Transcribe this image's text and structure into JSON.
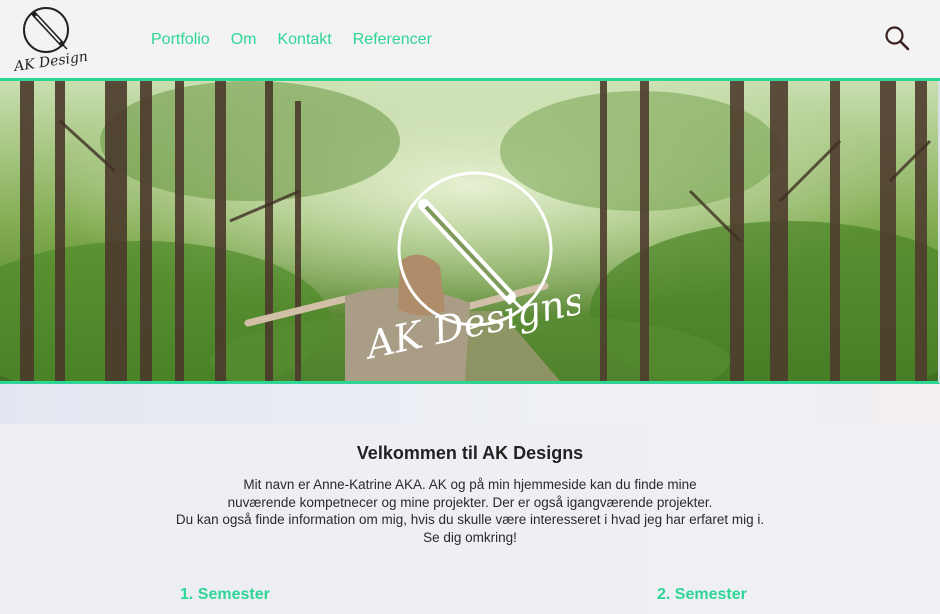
{
  "brand": {
    "logo_text": "AK Designs",
    "accent_color": "#2ed594"
  },
  "nav": {
    "items": [
      {
        "label": "Portfolio"
      },
      {
        "label": "Om"
      },
      {
        "label": "Kontakt"
      },
      {
        "label": "Referencer"
      }
    ],
    "search_icon": "search-icon"
  },
  "hero": {
    "image": "forest-woman-arms-outstretched",
    "overlay_logo_text": "AK Designs"
  },
  "welcome": {
    "title": "Velkommen til AK Designs",
    "lines": [
      "Mit navn er Anne-Katrine AKA. AK og på min hjemmeside kan du finde mine",
      "nuværende kompetnecer og mine projekter. Der er også igangværende projekter.",
      "Du kan også finde information om mig, hvis du skulle være interesseret i hvad jeg har erfaret mig i.",
      "Se dig omkring!"
    ]
  },
  "semesters": [
    {
      "label": "1. Semester"
    },
    {
      "label": "2. Semester"
    }
  ]
}
